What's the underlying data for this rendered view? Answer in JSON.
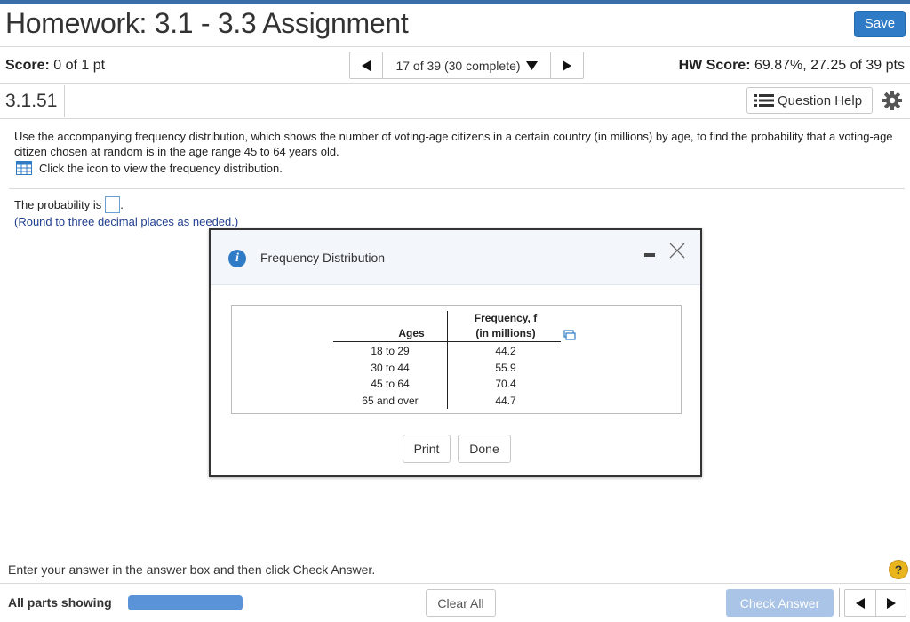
{
  "header": {
    "title": "Homework: 3.1 - 3.3 Assignment",
    "save_label": "Save"
  },
  "status": {
    "score_label": "Score:",
    "score_value": " 0 of 1 pt",
    "nav_label": "17 of 39 (30 complete)",
    "hw_label": "HW Score:",
    "hw_value": " 69.87%, 27.25 of 39 pts"
  },
  "question": {
    "number": "3.1.51",
    "help_label": "Question Help",
    "prompt": "Use the accompanying frequency distribution, which shows the number of voting-age citizens in a certain country (in millions) by age, to find the probability that a voting-age citizen chosen at random is in the age range 45 to 64 years old.",
    "icon_instruction": "Click the icon to view the frequency distribution.",
    "answer_prefix": "The probability is",
    "answer_suffix": ".",
    "round_note": "(Round to three decimal places as needed.)"
  },
  "dialog": {
    "title": "Frequency Distribution",
    "table": {
      "col_ages": "Ages",
      "col_freq_line1": "Frequency, f",
      "col_freq_line2": "(in millions)",
      "rows": [
        {
          "age": "18 to 29",
          "freq": "44.2"
        },
        {
          "age": "30 to 44",
          "freq": "55.9"
        },
        {
          "age": "45 to 64",
          "freq": "70.4"
        },
        {
          "age": "65 and over",
          "freq": "44.7"
        }
      ]
    },
    "print_label": "Print",
    "done_label": "Done"
  },
  "footer": {
    "instruction": "Enter your answer in the answer box and then click Check Answer.",
    "all_parts": "All parts showing",
    "clear_all": "Clear All",
    "check_answer": "Check Answer",
    "help_glyph": "?"
  },
  "colors": {
    "accent": "#2f7bc6",
    "progress": "#5b93d8",
    "check_disabled": "#a9c4e6",
    "help_yellow": "#e9b51c"
  }
}
